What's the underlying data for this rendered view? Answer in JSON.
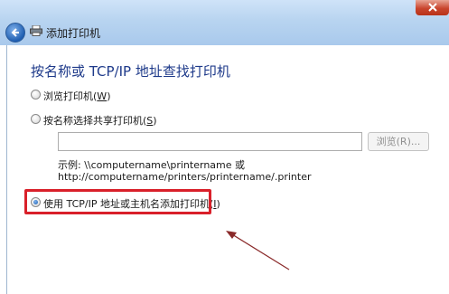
{
  "window": {
    "title": "添加打印机"
  },
  "main": {
    "heading": "按名称或 TCP/IP 地址查找打印机",
    "options": [
      {
        "label": "浏览打印机(",
        "key": "W",
        "suffix": ")",
        "selected": false
      },
      {
        "label": "按名称选择共享打印机(",
        "key": "S",
        "suffix": ")",
        "selected": false
      },
      {
        "label": "使用 TCP/IP 地址或主机名添加打印机(",
        "key": "I",
        "suffix": ")",
        "selected": true
      }
    ],
    "share_input_value": "",
    "browse_button": "浏览(R)...",
    "example_line1": "示例: \\\\computername\\printername 或",
    "example_line2": "http://computername/printers/printername/.printer"
  },
  "colors": {
    "highlight": "#d9202a",
    "heading": "#1e3a8a"
  }
}
